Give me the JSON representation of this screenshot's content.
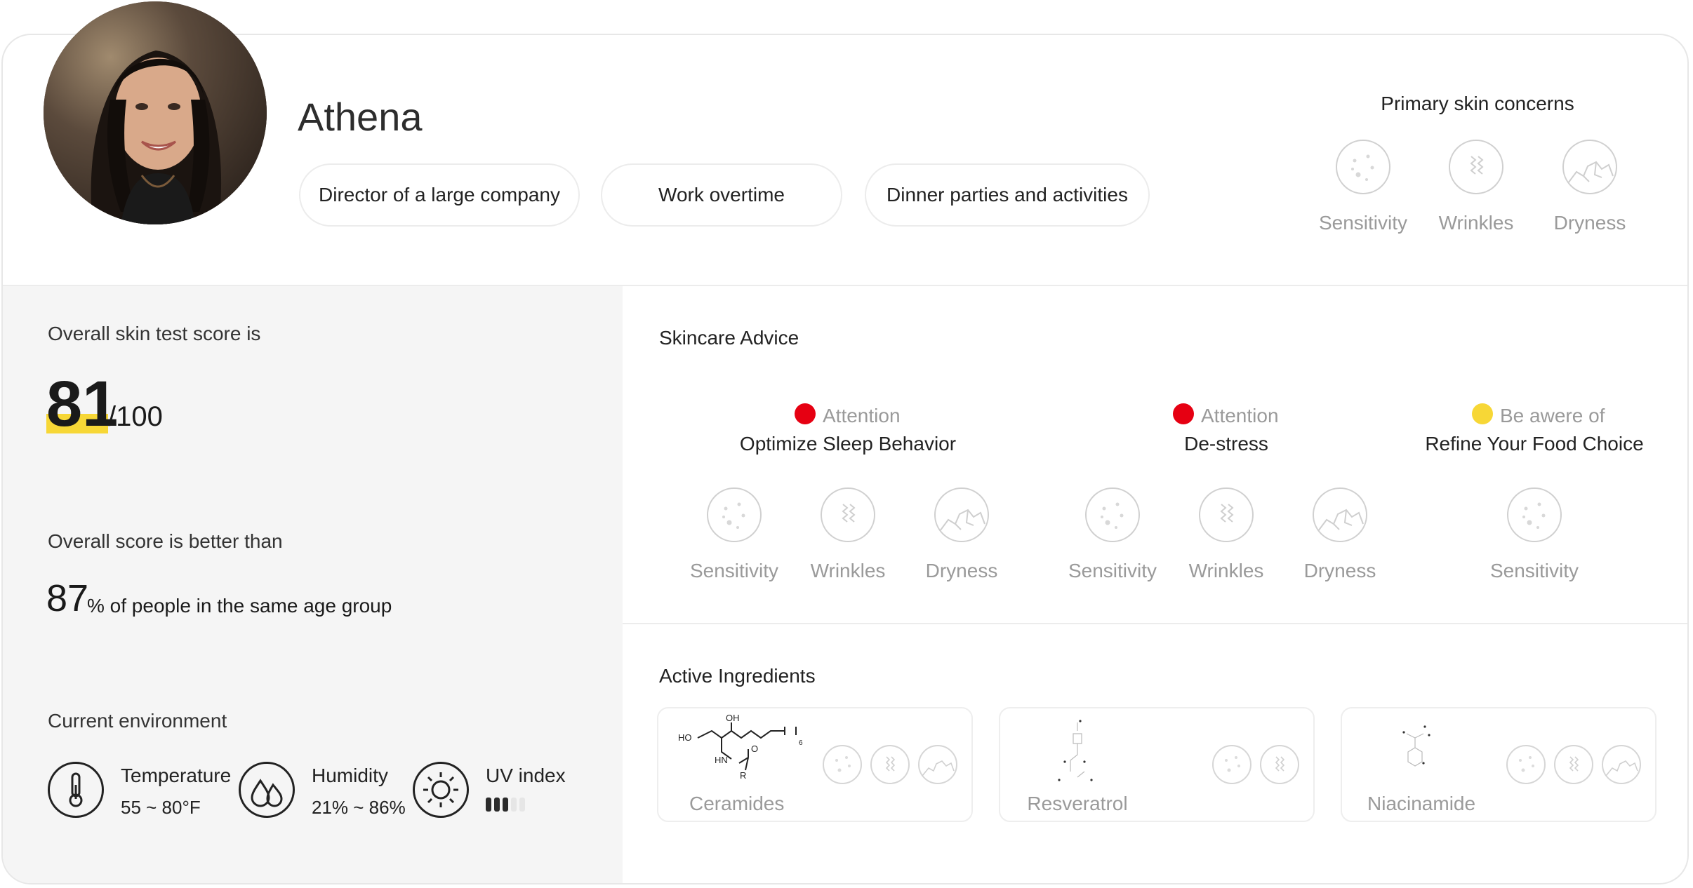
{
  "profile": {
    "name": "Athena",
    "tags": [
      "Director of a large company",
      "Work overtime",
      "Dinner parties and activities"
    ]
  },
  "primary_concerns": {
    "title": "Primary skin concerns",
    "items": [
      {
        "label": "Sensitivity",
        "icon": "sensitivity-icon"
      },
      {
        "label": "Wrinkles",
        "icon": "wrinkles-icon"
      },
      {
        "label": "Dryness",
        "icon": "dryness-icon"
      }
    ]
  },
  "score": {
    "label": "Overall skin test score is",
    "value": "81",
    "denominator": "/100",
    "comparison_label": "Overall score is better than",
    "percent": "87",
    "percent_suffix": "% of people in the same age group"
  },
  "environment": {
    "title": "Current environment",
    "temperature": {
      "label": "Temperature",
      "value": "55 ~ 80°F",
      "icon": "thermometer-icon"
    },
    "humidity": {
      "label": "Humidity",
      "value": "21% ~ 86%",
      "icon": "droplets-icon"
    },
    "uv": {
      "label": "UV index",
      "icon": "sun-icon",
      "level": 3,
      "max": 5
    }
  },
  "advice": {
    "title": "Skincare Advice",
    "groups": [
      {
        "status": "Attention",
        "status_color": "#e60012",
        "title": "Optimize Sleep Behavior",
        "items": [
          "Sensitivity",
          "Wrinkles",
          "Dryness"
        ]
      },
      {
        "status": "Attention",
        "status_color": "#e60012",
        "title": "De-stress",
        "items": [
          "Sensitivity",
          "Wrinkles",
          "Dryness"
        ]
      },
      {
        "status": "Be awere of",
        "status_color": "#f7d736",
        "title": "Refine Your Food Choice",
        "items": [
          "Sensitivity"
        ]
      }
    ]
  },
  "ingredients": {
    "title": "Active Ingredients",
    "items": [
      {
        "name": "Ceramides",
        "structure_labels": [
          "OH",
          "HO",
          "HN",
          "R",
          "O",
          "6"
        ]
      },
      {
        "name": "Resveratrol"
      },
      {
        "name": "Niacinamide"
      }
    ]
  },
  "colors": {
    "accent_yellow": "#f7d736",
    "attention_red": "#e60012",
    "muted_text": "#9a9a9a"
  }
}
